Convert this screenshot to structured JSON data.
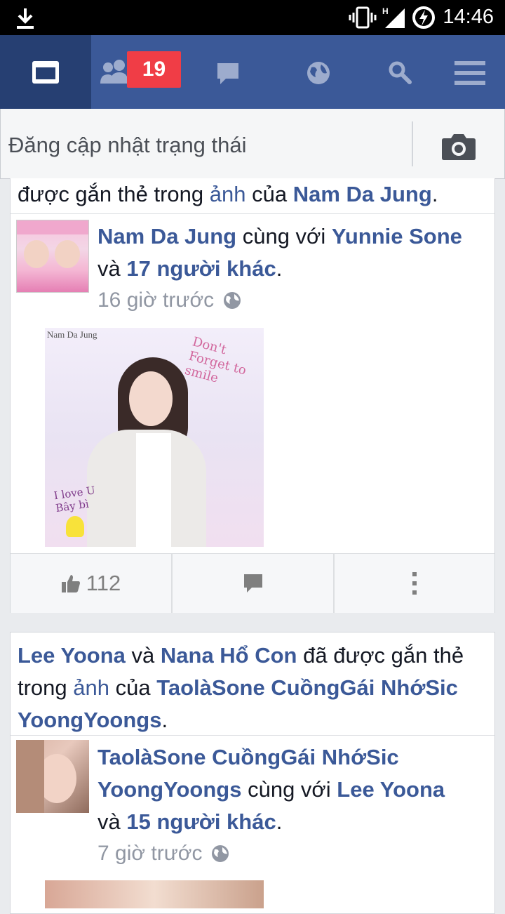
{
  "status_bar": {
    "time": "14:46"
  },
  "nav": {
    "friend_requests_count": "19"
  },
  "composer": {
    "placeholder": "Đăng cập nhật trạng thái"
  },
  "post1": {
    "header": {
      "t1": "được gắn thẻ trong ",
      "l1": "ảnh",
      "t2": " của ",
      "l2": "Nam Da Jung",
      "t3": "."
    },
    "author": "Nam Da Jung",
    "with": " cùng với ",
    "tagged": "Yunnie Sone",
    "and": "và ",
    "others": "17 người khác",
    "dot": ".",
    "time": "16 giờ trước",
    "photo_caption": "Nam Da Jung",
    "likes": "112"
  },
  "post2": {
    "h1": "Lee Yoona",
    "h2": " và ",
    "h3": "Nana Hổ Con",
    "h4": " đã được gắn thẻ",
    "h5": "trong ",
    "h6": "ảnh",
    "h7": " của ",
    "h8": "TaolàSone CuồngGái NhớSic",
    "h9": "YoongYoongs",
    "h10": ".",
    "author_line1": "TaolàSone CuồngGái NhớSic",
    "author_line2": "YoongYoongs",
    "with": " cùng với ",
    "tagged": "Lee Yoona",
    "and": "và ",
    "others": "15 người khác",
    "dot": ".",
    "time": "7 giờ trước"
  }
}
